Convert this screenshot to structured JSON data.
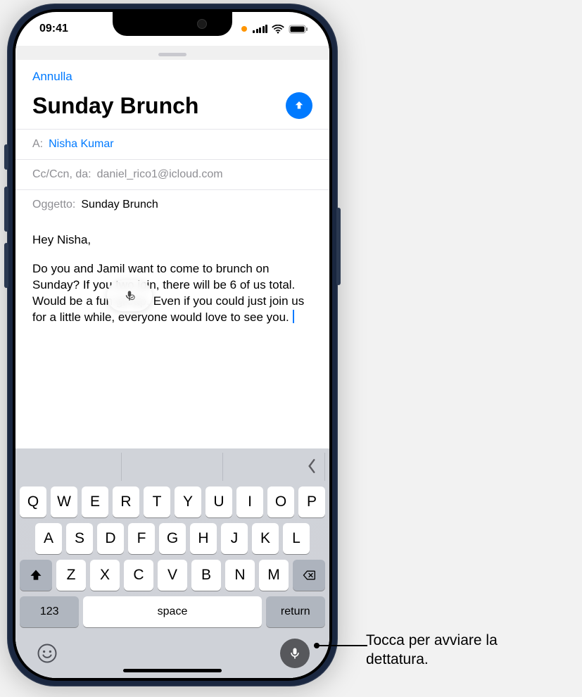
{
  "status": {
    "time": "09:41"
  },
  "nav": {
    "cancel": "Annulla"
  },
  "compose": {
    "title": "Sunday Brunch",
    "to_label": "A:",
    "to_name": "Nisha Kumar",
    "cc_label": "Cc/Ccn, da:",
    "cc_value": "daniel_rico1@icloud.com",
    "subject_label": "Oggetto:",
    "subject_value": "Sunday Brunch",
    "body_greeting": "Hey Nisha,",
    "body_para": "Do you and Jamil want to come to brunch on Sunday? If you two join, there will be 6 of us total. Would be a fun group. Even if you could just join us for a little while, everyone would love to see you."
  },
  "keyboard": {
    "row1": [
      "Q",
      "W",
      "E",
      "R",
      "T",
      "Y",
      "U",
      "I",
      "O",
      "P"
    ],
    "row2": [
      "A",
      "S",
      "D",
      "F",
      "G",
      "H",
      "J",
      "K",
      "L"
    ],
    "row3": [
      "Z",
      "X",
      "C",
      "V",
      "B",
      "N",
      "M"
    ],
    "k123": "123",
    "space": "space",
    "return": "return"
  },
  "callout": {
    "line1": "Tocca per avviare la",
    "line2": "dettatura."
  }
}
